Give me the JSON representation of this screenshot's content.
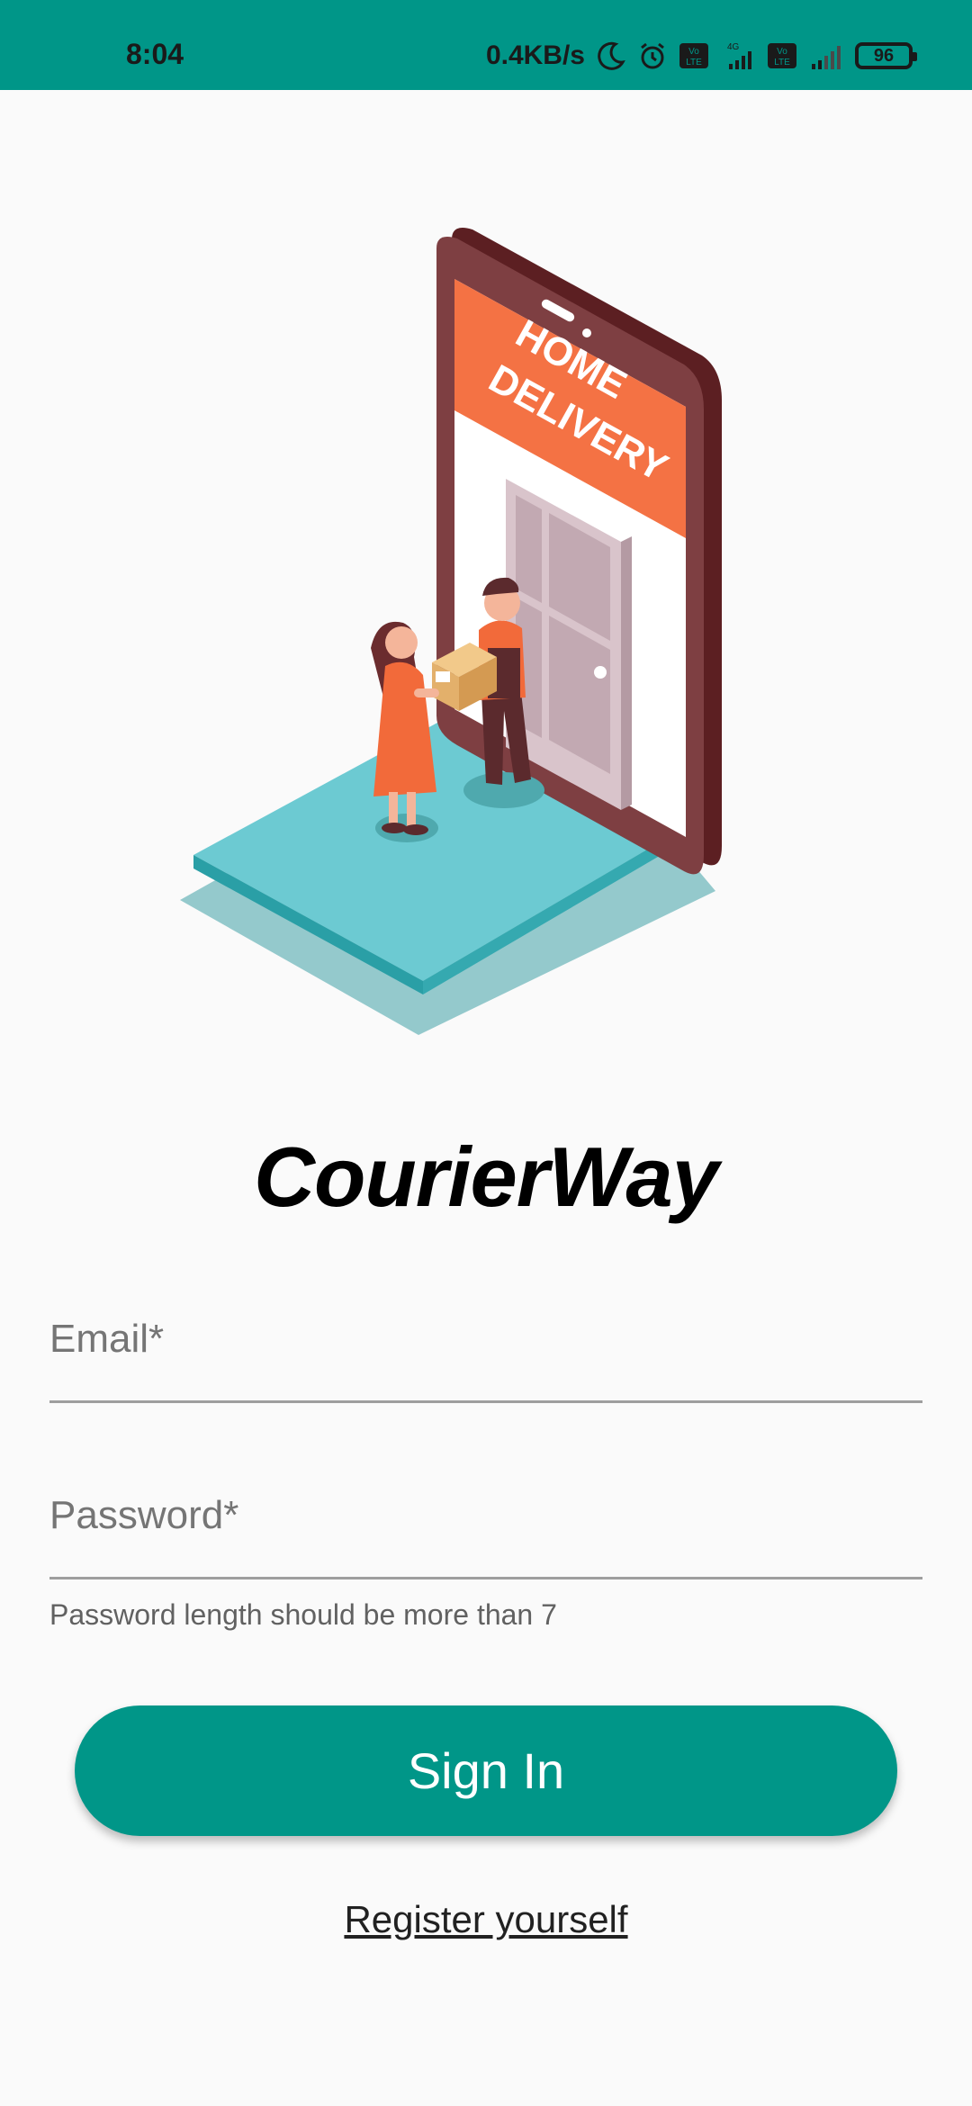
{
  "status_bar": {
    "time": "8:04",
    "net_speed": "0.4KB/s",
    "battery": "96",
    "icons": [
      "moon-icon",
      "alarm-icon",
      "volte-icon",
      "4g-signal-icon",
      "volte-icon",
      "signal-icon",
      "battery-icon"
    ]
  },
  "illustration": {
    "banner_line1": "HOME",
    "banner_line2": "DELIVERY"
  },
  "app": {
    "title": "CourierWay"
  },
  "form": {
    "email_placeholder": "Email*",
    "email_value": "",
    "password_placeholder": "Password*",
    "password_value": "",
    "password_helper": "Password length should be more than 7",
    "sign_in_label": "Sign In",
    "register_label": "Register yourself"
  },
  "colors": {
    "primary": "#009688",
    "background": "#fafafa"
  }
}
